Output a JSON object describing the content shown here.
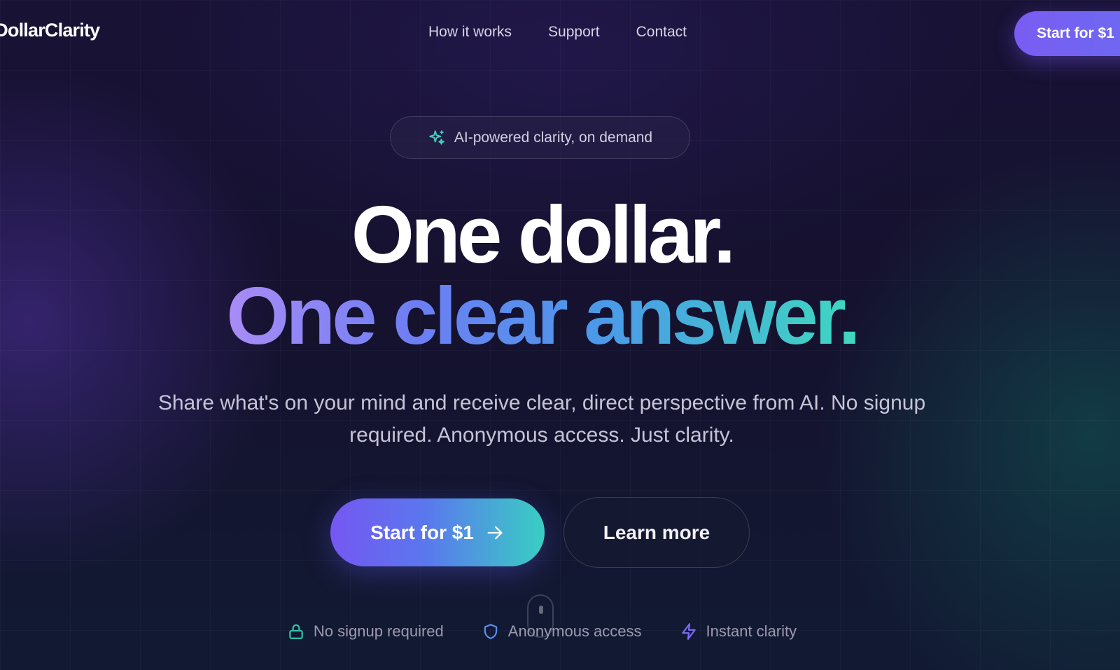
{
  "header": {
    "logo_text": "eDollarClarity",
    "nav": [
      {
        "label": "How it works"
      },
      {
        "label": "Support"
      },
      {
        "label": "Contact"
      }
    ],
    "cta_label": "Start for $1"
  },
  "hero": {
    "badge_icon": "sparkle-icon",
    "badge_text": "AI-powered clarity, on demand",
    "headline_line1": "One dollar.",
    "headline_line2": "One clear answer.",
    "subtitle": "Share what's on your mind and receive clear, direct perspective from AI. No signup required. Anonymous access. Just clarity.",
    "primary_button": {
      "label": "Start for $1",
      "icon": "arrow-right-icon"
    },
    "secondary_button": {
      "label": "Learn more"
    }
  },
  "features": [
    {
      "icon": "lock-icon",
      "label": "No signup required",
      "color": "#2fc6a8"
    },
    {
      "icon": "shield-icon",
      "label": "Anonymous access",
      "color": "#5b8ef0"
    },
    {
      "icon": "lightning-icon",
      "label": "Instant clarity",
      "color": "#7b6cf2"
    }
  ],
  "colors": {
    "background": "#140f2c",
    "accent_purple": "#7557f2",
    "accent_teal": "#39cfc3"
  }
}
